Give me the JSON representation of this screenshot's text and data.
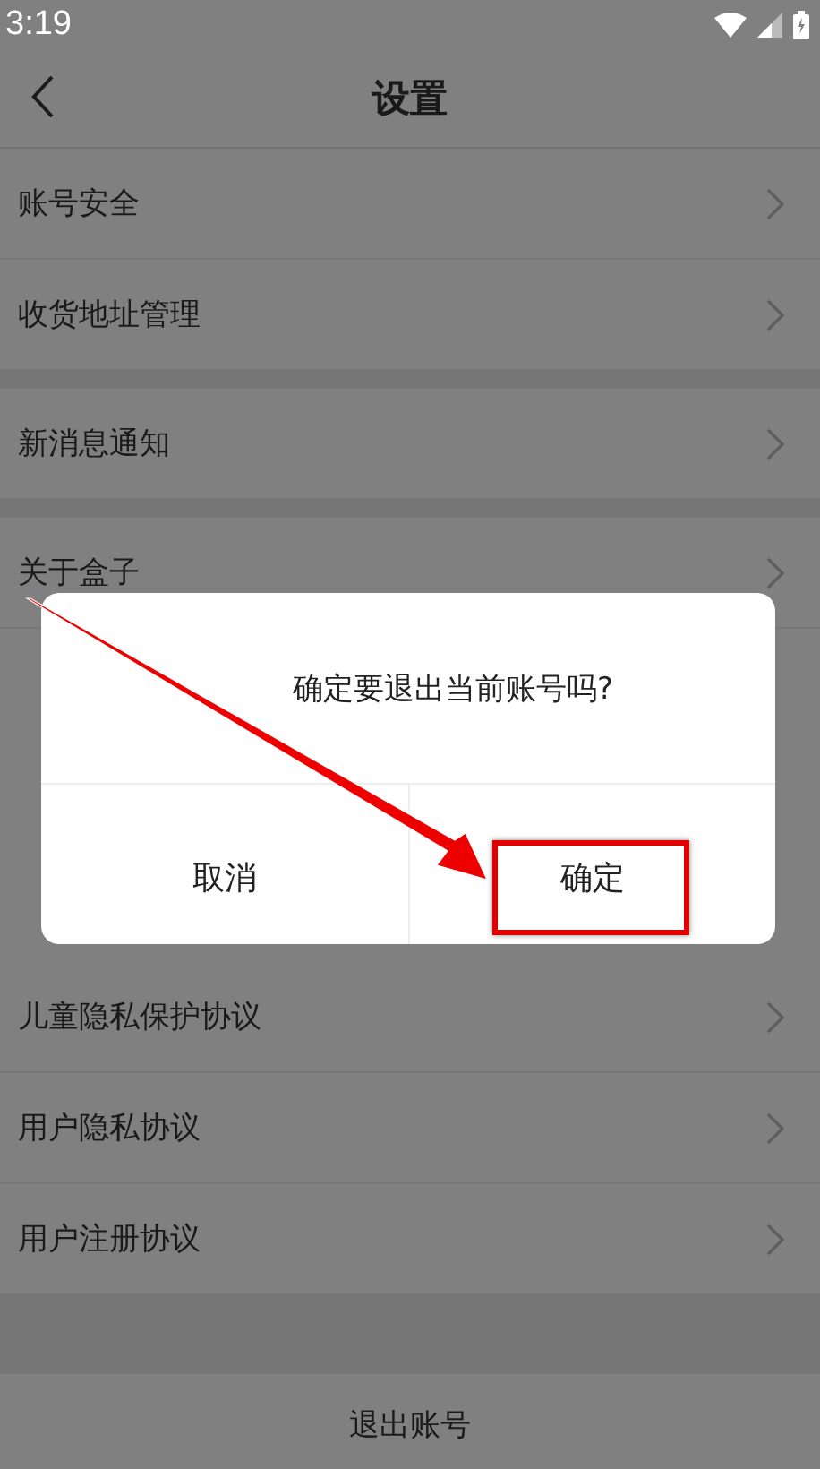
{
  "status_bar": {
    "time": "3:19"
  },
  "header": {
    "title": "设置"
  },
  "groups": [
    {
      "items": [
        {
          "label": "账号安全"
        },
        {
          "label": "收货地址管理"
        }
      ]
    },
    {
      "items": [
        {
          "label": "新消息通知"
        }
      ]
    },
    {
      "items": [
        {
          "label": "关于盒子"
        },
        {
          "label": "儿童隐私保护协议"
        },
        {
          "label": "用户隐私协议"
        },
        {
          "label": "用户注册协议"
        }
      ]
    }
  ],
  "logout": {
    "label": "退出账号"
  },
  "dialog": {
    "message": "确定要退出当前账号吗?",
    "buttons": [
      {
        "label": "取消",
        "highlighted": false
      },
      {
        "label": "确定",
        "highlighted": true
      }
    ]
  }
}
